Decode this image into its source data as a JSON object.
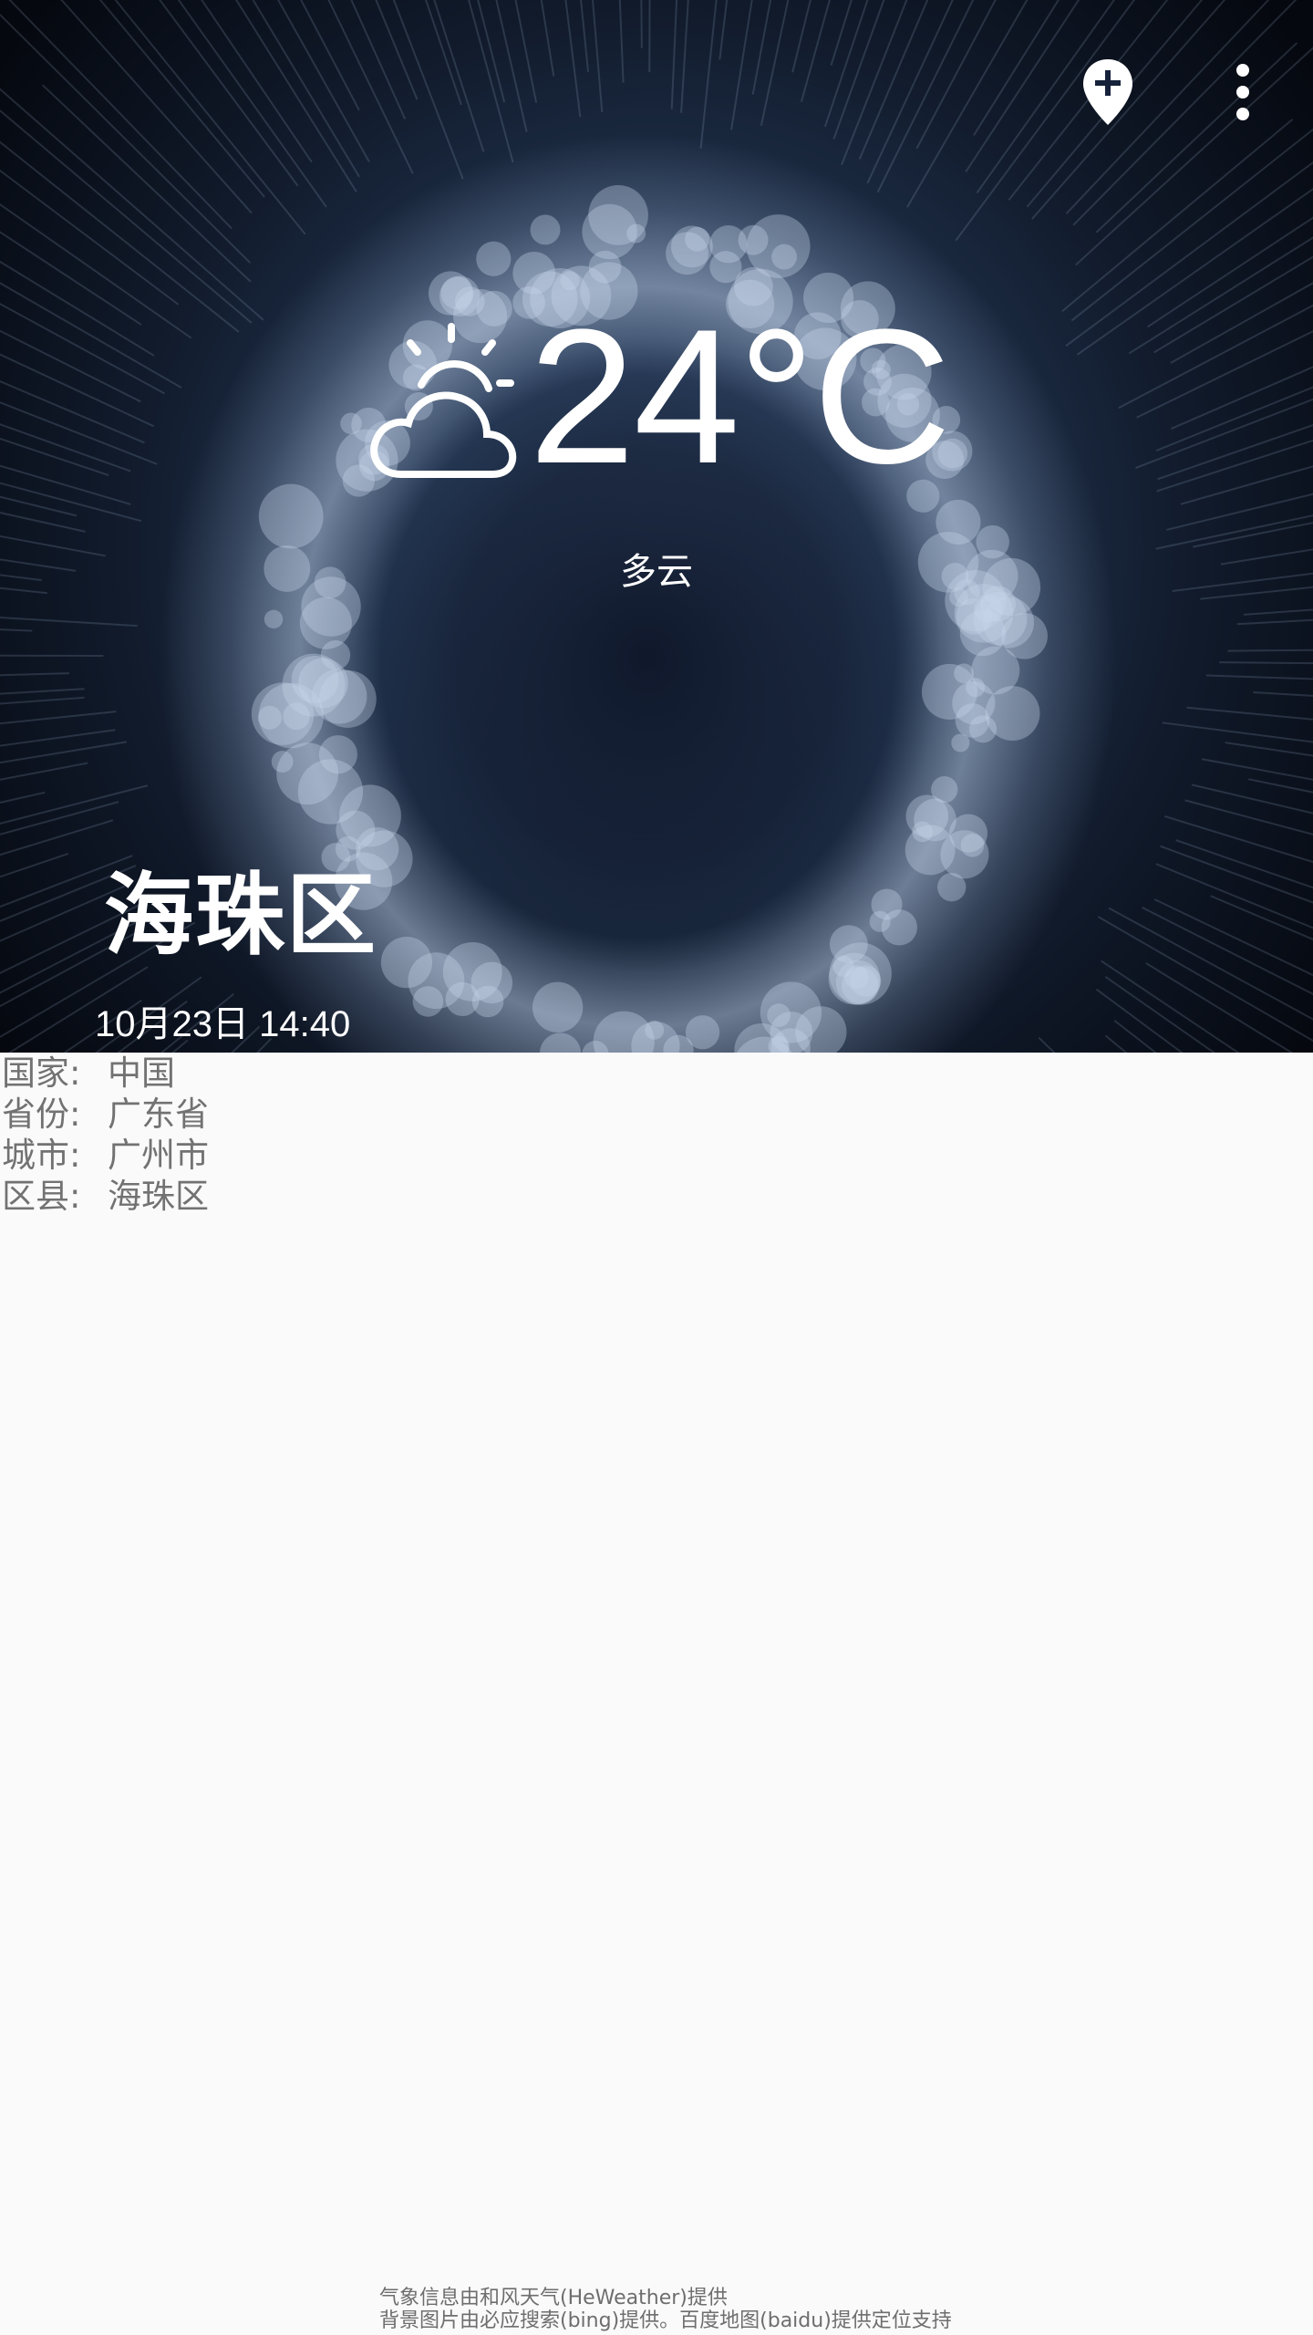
{
  "weather": {
    "temperature": "24°C",
    "condition": "多云",
    "icon": "partly-cloudy-icon"
  },
  "location": {
    "district": "海珠区",
    "datetime": "10月23日 14:40"
  },
  "actions": {
    "add_location_icon": "add-location-icon",
    "more_icon": "more-vert-icon"
  },
  "details": [
    {
      "label": "国家:",
      "value": "中国"
    },
    {
      "label": "省份:",
      "value": "广东省"
    },
    {
      "label": "城市:",
      "value": "广州市"
    },
    {
      "label": "区县:",
      "value": "海珠区"
    }
  ],
  "footer": {
    "line1": "气象信息由和风天气(HeWeather)提供",
    "line2": "背景图片由必应搜索(bing)提供。百度地图(baidu)提供定位支持"
  },
  "colors": {
    "background": "#fafafa",
    "hero_text": "#ffffff",
    "detail_text": "#727272"
  }
}
